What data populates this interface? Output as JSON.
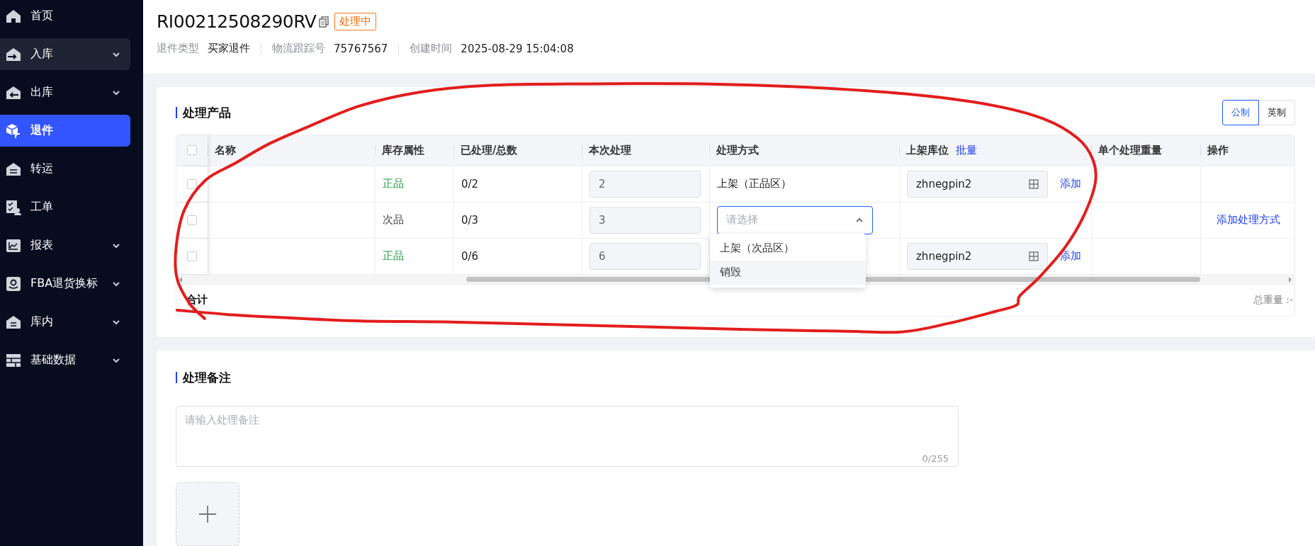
{
  "sidebar": {
    "items": [
      {
        "label": "首页",
        "kind": "home",
        "expandable": false,
        "hovered": false,
        "selected": false
      },
      {
        "label": "入库",
        "kind": "inbound",
        "expandable": true,
        "hovered": true,
        "selected": false
      },
      {
        "label": "出库",
        "kind": "outbound",
        "expandable": true,
        "hovered": false,
        "selected": false
      },
      {
        "label": "退件",
        "kind": "returns",
        "expandable": false,
        "hovered": false,
        "selected": true
      },
      {
        "label": "转运",
        "kind": "transfer",
        "expandable": false,
        "hovered": false,
        "selected": false
      },
      {
        "label": "工单",
        "kind": "workorder",
        "expandable": false,
        "hovered": false,
        "selected": false
      },
      {
        "label": "报表",
        "kind": "report",
        "expandable": true,
        "hovered": false,
        "selected": false
      },
      {
        "label": "FBA退货换标",
        "kind": "smilebox",
        "expandable": true,
        "hovered": false,
        "selected": false
      },
      {
        "label": "库内",
        "kind": "warehouse",
        "expandable": true,
        "hovered": false,
        "selected": false
      },
      {
        "label": "基础数据",
        "kind": "data",
        "expandable": true,
        "hovered": false,
        "selected": false
      }
    ]
  },
  "header": {
    "title": "RI00212508290RV",
    "status": "处理中",
    "meta": [
      {
        "label": "退件类型",
        "value": "买家退件"
      },
      {
        "label": "物流跟踪号",
        "value": "75767567"
      },
      {
        "label": "创建时间",
        "value": "2025-08-29 15:04:08"
      }
    ]
  },
  "products": {
    "title": "处理产品",
    "units": [
      {
        "label": "公制",
        "selected": true
      },
      {
        "label": "英制",
        "selected": false
      }
    ],
    "table": {
      "all_checked": false,
      "columns": [
        {
          "label": "名称"
        },
        {
          "label": "库存属性"
        },
        {
          "label": "已处理/总数"
        },
        {
          "label": "本次处理"
        },
        {
          "label": "处理方式"
        },
        {
          "label": "上架库位",
          "action": "批量"
        },
        {
          "label": "单个处理重量"
        },
        {
          "label": "操作"
        }
      ],
      "rows": [
        {
          "checked": false,
          "attribute": "正品",
          "color": "#20a045",
          "progress": "0/2",
          "quantity": "2",
          "method": {
            "kind": "text",
            "text": "上架（正品区）"
          },
          "location": "zhnegpin2",
          "location_action": "添加"
        },
        {
          "checked": false,
          "attribute": "次品",
          "color": "#444444",
          "progress": "0/3",
          "quantity": "3",
          "method": {
            "kind": "select",
            "placeholder": "请选择",
            "open": true,
            "options": [
              {
                "label": "上架（次品区）",
                "hovered": false
              },
              {
                "label": "销毁",
                "hovered": true
              }
            ]
          },
          "operation": "添加处理方式"
        },
        {
          "checked": false,
          "attribute": "正品",
          "color": "#20a045",
          "progress": "0/6",
          "quantity": "6",
          "location": "zhnegpin2",
          "location_action": "添加"
        }
      ],
      "total_label": "合计",
      "total_weight": "总重量 :-"
    }
  },
  "remarks": {
    "title": "处理备注",
    "placeholder": "请输入处理备注",
    "counter": "0/255"
  }
}
